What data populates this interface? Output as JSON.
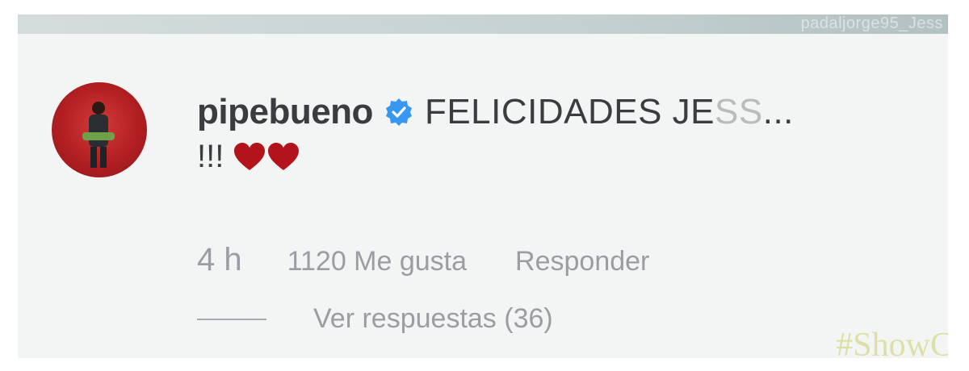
{
  "overlay": {
    "tagged_user": "padaljorge95_Jess"
  },
  "comment": {
    "username": "pipebueno",
    "text_visible": "FELICIDADES JE",
    "text_faded": "SS",
    "ellipsis": "...",
    "line2_text": "!!!",
    "hearts_count": 2,
    "verified": true,
    "time": "4 h",
    "likes": "1120 Me gusta",
    "reply_label": "Responder",
    "view_replies_label": "Ver respuestas (36)"
  },
  "watermark": {
    "text": "#ShowC"
  },
  "colors": {
    "verified_blue": "#3897f0",
    "heart_red": "#b3141c",
    "avatar_red": "#c62a2d",
    "text_dark": "#3a3d40",
    "text_muted": "#9a9ea2"
  },
  "icons": {
    "verified": "verified-badge-icon",
    "heart": "heart-icon"
  }
}
